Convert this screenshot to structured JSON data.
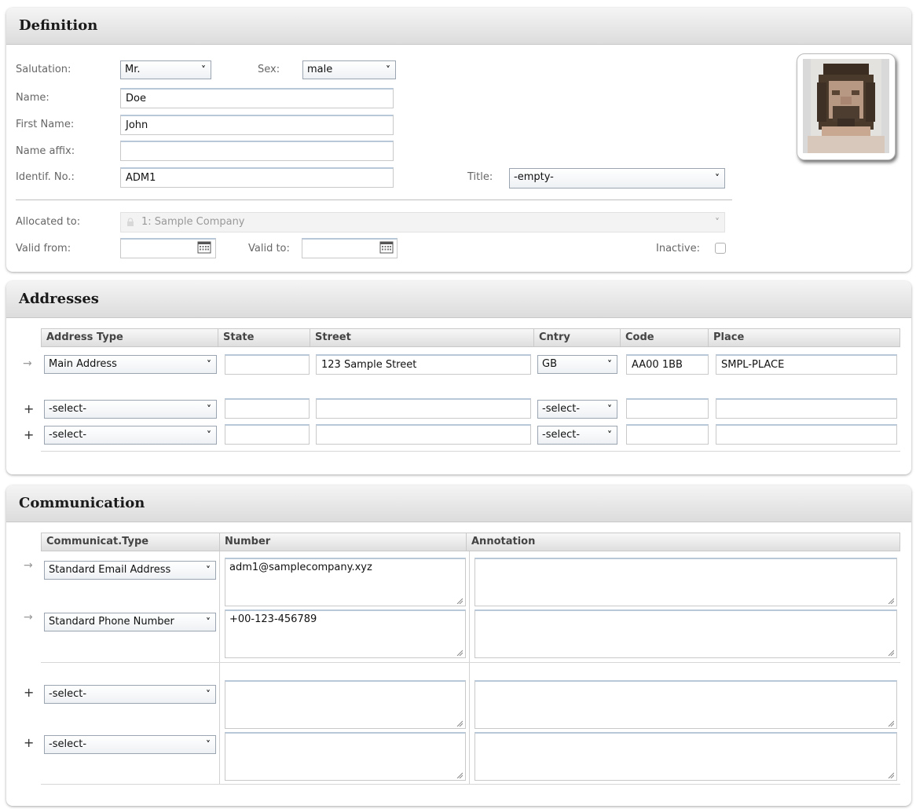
{
  "definition": {
    "title": "Definition",
    "salutation_label": "Salutation:",
    "salutation_value": "Mr.",
    "sex_label": "Sex:",
    "sex_value": "male",
    "name_label": "Name:",
    "name_value": "Doe",
    "first_name_label": "First Name:",
    "first_name_value": "John",
    "name_affix_label": "Name affix:",
    "name_affix_value": "",
    "identif_label": "Identif. No.:",
    "identif_value": "ADM1",
    "title_label": "Title:",
    "title_value": "-empty-",
    "allocated_label": "Allocated to:",
    "allocated_value": "1: Sample Company",
    "valid_from_label": "Valid from:",
    "valid_from_value": "",
    "valid_to_label": "Valid to:",
    "valid_to_value": "",
    "inactive_label": "Inactive:"
  },
  "addresses": {
    "title": "Addresses",
    "columns": [
      "Address Type",
      "State",
      "Street",
      "Cntry",
      "Code",
      "Place"
    ],
    "rows": [
      {
        "marker": "→",
        "type": "Main Address",
        "state": "",
        "street": "123 Sample Street",
        "country": "GB",
        "code": "AA00 1BB",
        "place": "SMPL-PLACE"
      },
      {
        "marker": "+",
        "type": "-select-",
        "state": "",
        "street": "",
        "country": "-select-",
        "code": "",
        "place": ""
      },
      {
        "marker": "+",
        "type": "-select-",
        "state": "",
        "street": "",
        "country": "-select-",
        "code": "",
        "place": ""
      }
    ]
  },
  "communication": {
    "title": "Communication",
    "columns": [
      "Communicat.Type",
      "Number",
      "Annotation"
    ],
    "rows": [
      {
        "marker": "→",
        "type": "Standard Email Address",
        "number": "adm1@samplecompany.xyz",
        "annotation": ""
      },
      {
        "marker": "→",
        "type": "Standard Phone Number",
        "number": "+00-123-456789",
        "annotation": ""
      },
      {
        "marker": "+",
        "type": "-select-",
        "number": "",
        "annotation": ""
      },
      {
        "marker": "+",
        "type": "-select-",
        "number": "",
        "annotation": ""
      }
    ]
  },
  "icons": {
    "dropdown": "chevron-down-icon",
    "calendar": "calendar-icon",
    "lock": "lock-icon",
    "resize": "resize-grip-icon",
    "existing_row": "arrow-right-icon",
    "new_row": "plus-icon"
  },
  "colors": {
    "header_gradient_top": "#f4f4f4",
    "header_gradient_bottom": "#dcdcdc",
    "input_top_border": "#b8c8d8",
    "select_border": "#9aa5b1"
  }
}
